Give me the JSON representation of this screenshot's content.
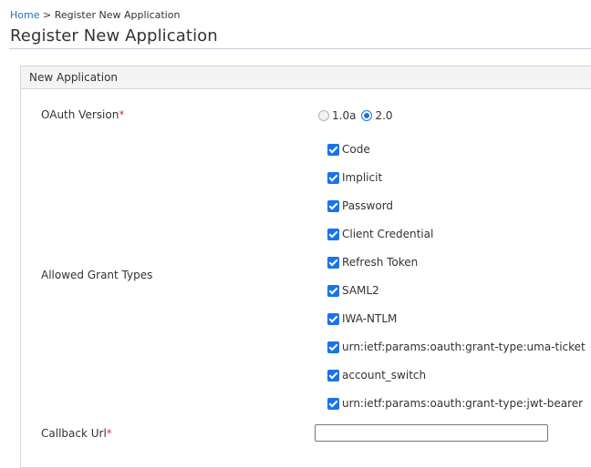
{
  "breadcrumb": {
    "home": "Home",
    "separator": ">",
    "current": "Register New Application"
  },
  "page_title": "Register New Application",
  "panel": {
    "title": "New Application"
  },
  "form": {
    "oauth_version": {
      "label": "OAuth Version",
      "required_mark": "*",
      "options": [
        {
          "label": "1.0a",
          "selected": false
        },
        {
          "label": "2.0",
          "selected": true
        }
      ]
    },
    "grant_types": {
      "label": "Allowed Grant Types",
      "items": [
        {
          "label": "Code",
          "checked": true
        },
        {
          "label": "Implicit",
          "checked": true
        },
        {
          "label": "Password",
          "checked": true
        },
        {
          "label": "Client Credential",
          "checked": true
        },
        {
          "label": "Refresh Token",
          "checked": true
        },
        {
          "label": "SAML2",
          "checked": true
        },
        {
          "label": "IWA-NTLM",
          "checked": true
        },
        {
          "label": "urn:ietf:params:oauth:grant-type:uma-ticket",
          "checked": true
        },
        {
          "label": "account_switch",
          "checked": true
        },
        {
          "label": "urn:ietf:params:oauth:grant-type:jwt-bearer",
          "checked": true
        }
      ]
    },
    "callback_url": {
      "label": "Callback Url",
      "required_mark": "*",
      "value": ""
    }
  },
  "colors": {
    "accent": "#1a73e8",
    "required": "#e0342a",
    "link": "#2b6cb0"
  }
}
